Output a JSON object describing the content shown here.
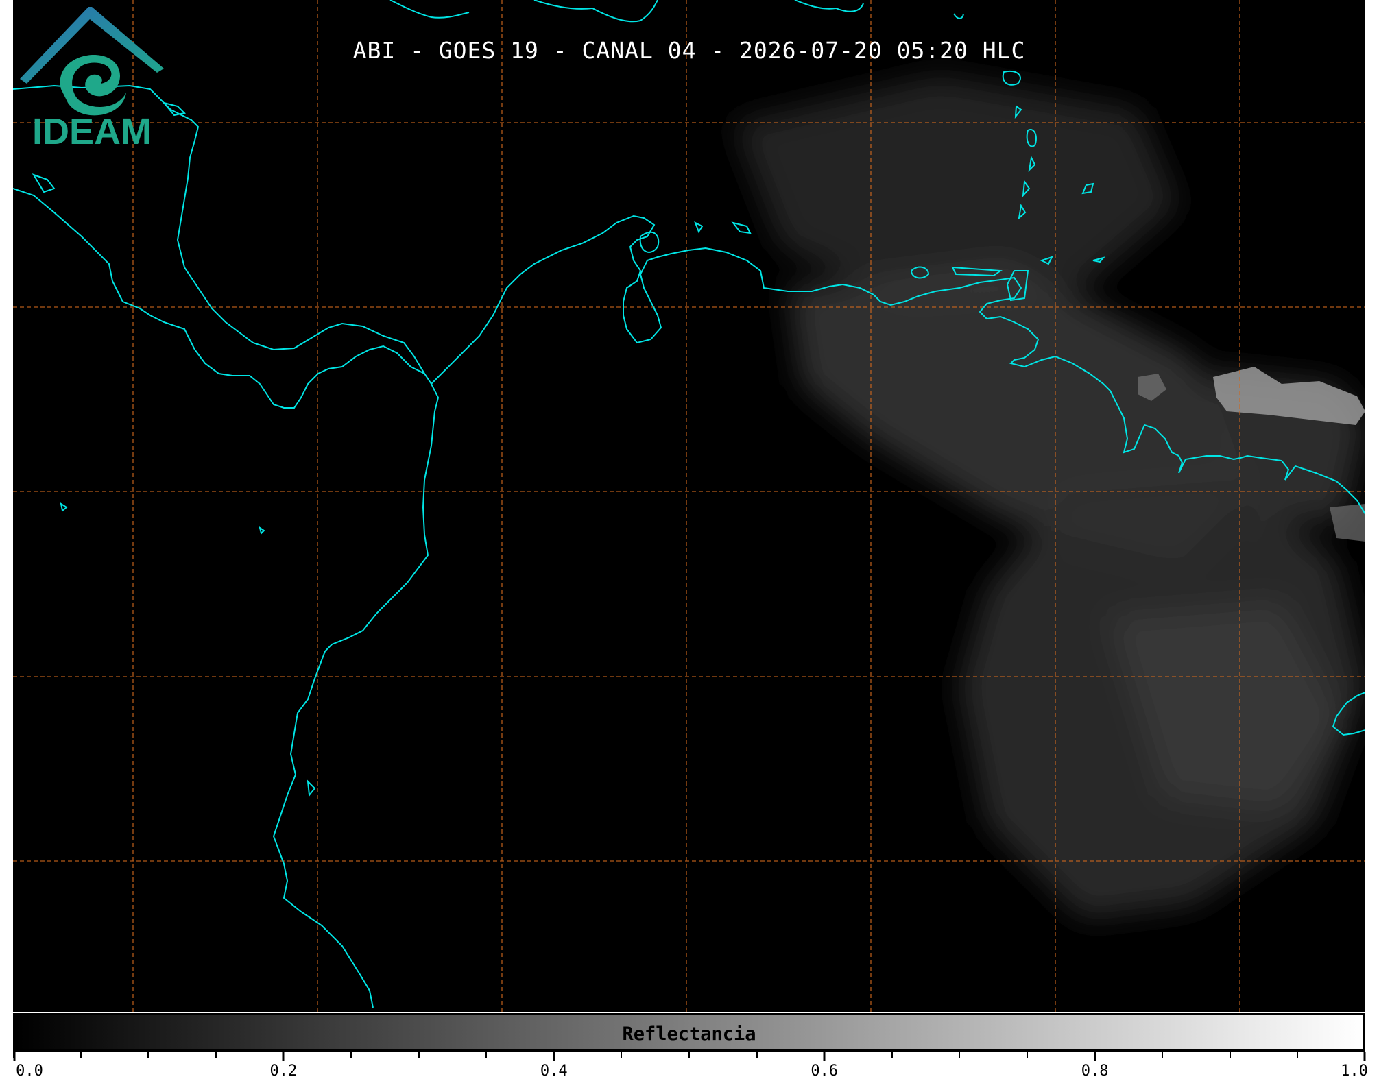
{
  "title": "ABI - GOES 19 - CANAL 04 - 2026-07-20 05:20 HLC",
  "colors": {
    "background": "#000000",
    "coastline": "#00e5e5",
    "gridline": "#d2691e",
    "logo_teal": "#1fa88a",
    "logo_blue": "#2a6fb3"
  },
  "logo": {
    "text": "IDEAM"
  },
  "colorbar": {
    "label": "Reflectancia",
    "min": 0.0,
    "max": 1.0,
    "colormap": "gray",
    "ticks": [
      {
        "value": 0.0,
        "label": "0.0"
      },
      {
        "value": 0.2,
        "label": "0.2"
      },
      {
        "value": 0.4,
        "label": "0.4"
      },
      {
        "value": 0.6,
        "label": "0.6"
      },
      {
        "value": 0.8,
        "label": "0.8"
      },
      {
        "value": 1.0,
        "label": "1.0"
      }
    ],
    "minor_step": 0.05
  }
}
